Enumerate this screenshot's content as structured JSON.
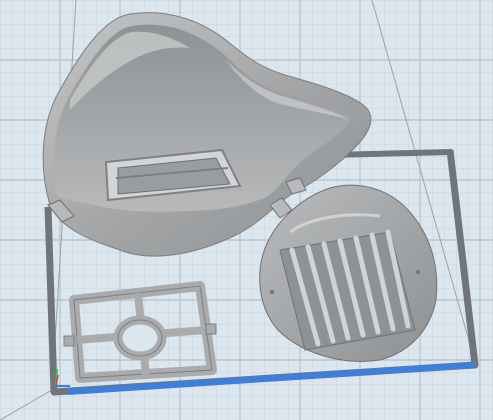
{
  "viewport": {
    "background_color": "#dce6ee",
    "grid_line_color": "#b7c5d2",
    "grid_line_light_color": "#e9f0f5",
    "build_plate_border_color": "#6f757a",
    "x_axis_color": "#3b7fe0",
    "y_axis_color": "#39c23b",
    "z_axis_color": "#e03b3b",
    "model_color": "#a9abad",
    "model_shadow_color": "#808386",
    "model_highlight_color": "#d4d6d8"
  },
  "objects": [
    {
      "name": "mask-body",
      "icon": "mask-shell-model"
    },
    {
      "name": "filter-cap",
      "icon": "vented-cap-model"
    },
    {
      "name": "filter-frame",
      "icon": "square-frame-model"
    }
  ],
  "axes": [
    {
      "name": "x-axis",
      "icon": "x-axis-icon"
    },
    {
      "name": "y-axis",
      "icon": "y-axis-icon"
    },
    {
      "name": "z-axis",
      "icon": "z-axis-icon"
    }
  ]
}
